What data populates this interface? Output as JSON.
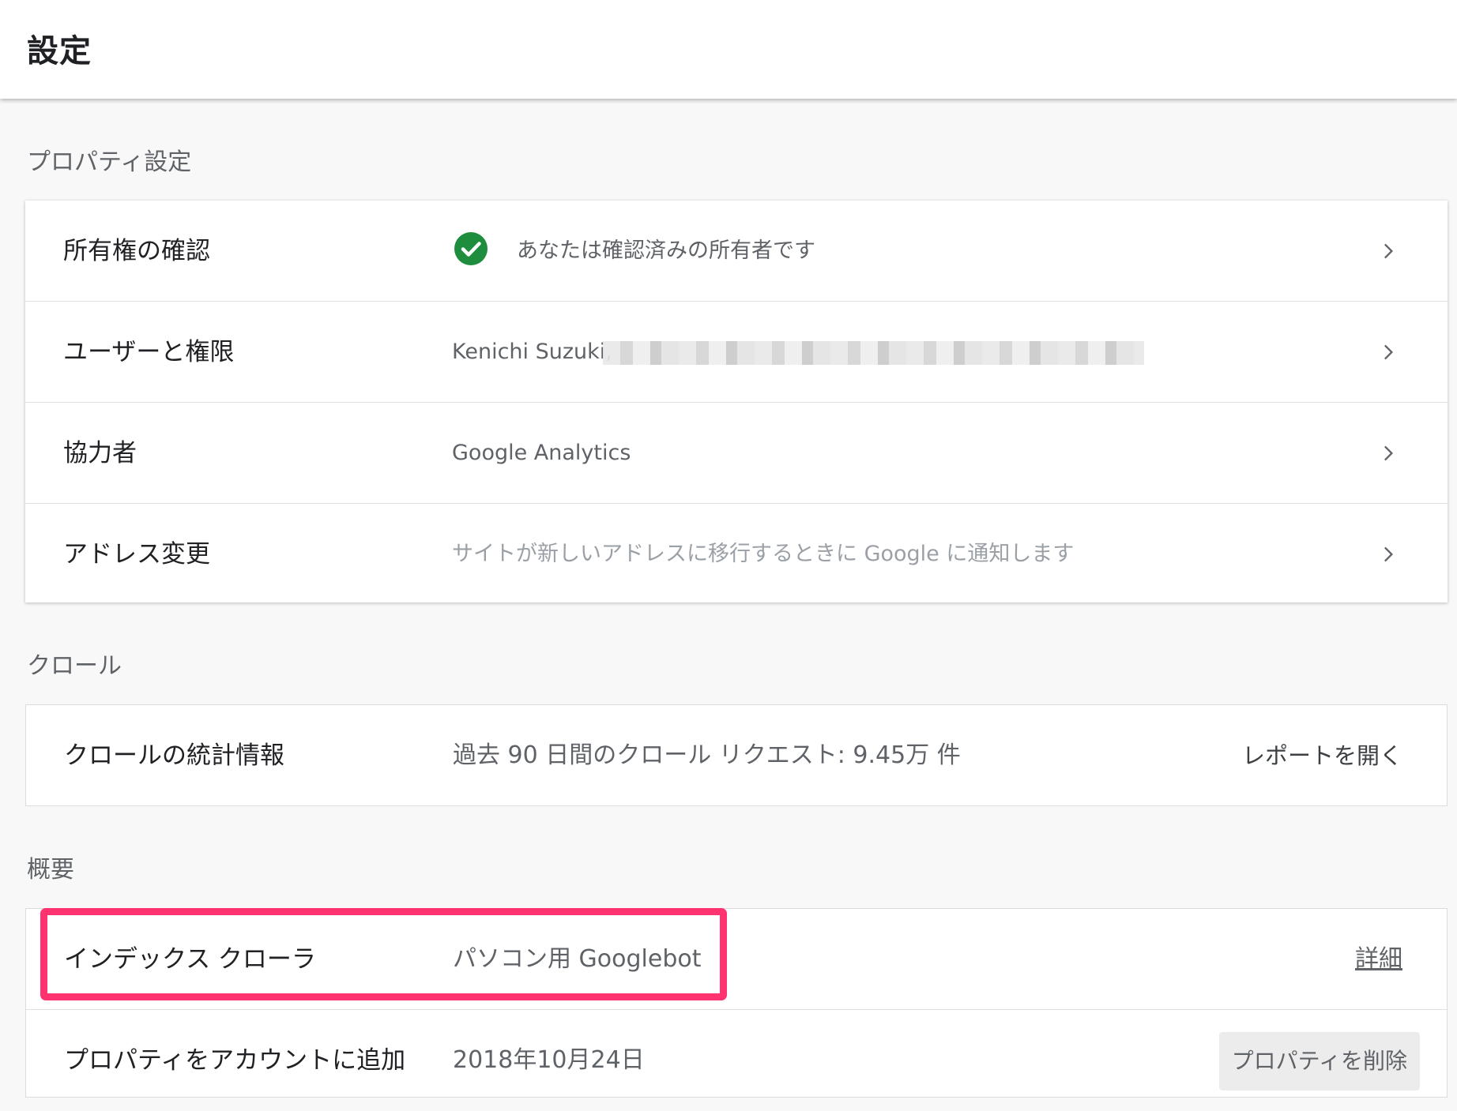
{
  "header": {
    "title": "設定"
  },
  "property_settings": {
    "label": "プロパティ設定",
    "rows": [
      {
        "label": "所有権の確認",
        "value": "あなたは確認済みの所有者です"
      },
      {
        "label": "ユーザーと権限",
        "value": "Kenichi Suzuki,"
      },
      {
        "label": "協力者",
        "value": "Google Analytics"
      },
      {
        "label": "アドレス変更",
        "value": "サイトが新しいアドレスに移行するときに Google に通知します"
      }
    ]
  },
  "crawl": {
    "label": "クロール",
    "rows": [
      {
        "label": "クロールの統計情報",
        "value": "過去 90 日間のクロール リクエスト: 9.45万 件",
        "action": "レポートを開く"
      }
    ]
  },
  "overview": {
    "label": "概要",
    "rows": [
      {
        "label": "インデックス クローラ",
        "value": "パソコン用 Googlebot",
        "action": "詳細"
      },
      {
        "label": "プロパティをアカウントに追加",
        "value": "2018年10月24日",
        "action": "プロパティを削除"
      }
    ]
  },
  "colors": {
    "verified_check": "#1e8e3e",
    "highlight_border": "#ff3370"
  },
  "icons": [
    "check-circle-icon",
    "chevron-right-icon"
  ]
}
